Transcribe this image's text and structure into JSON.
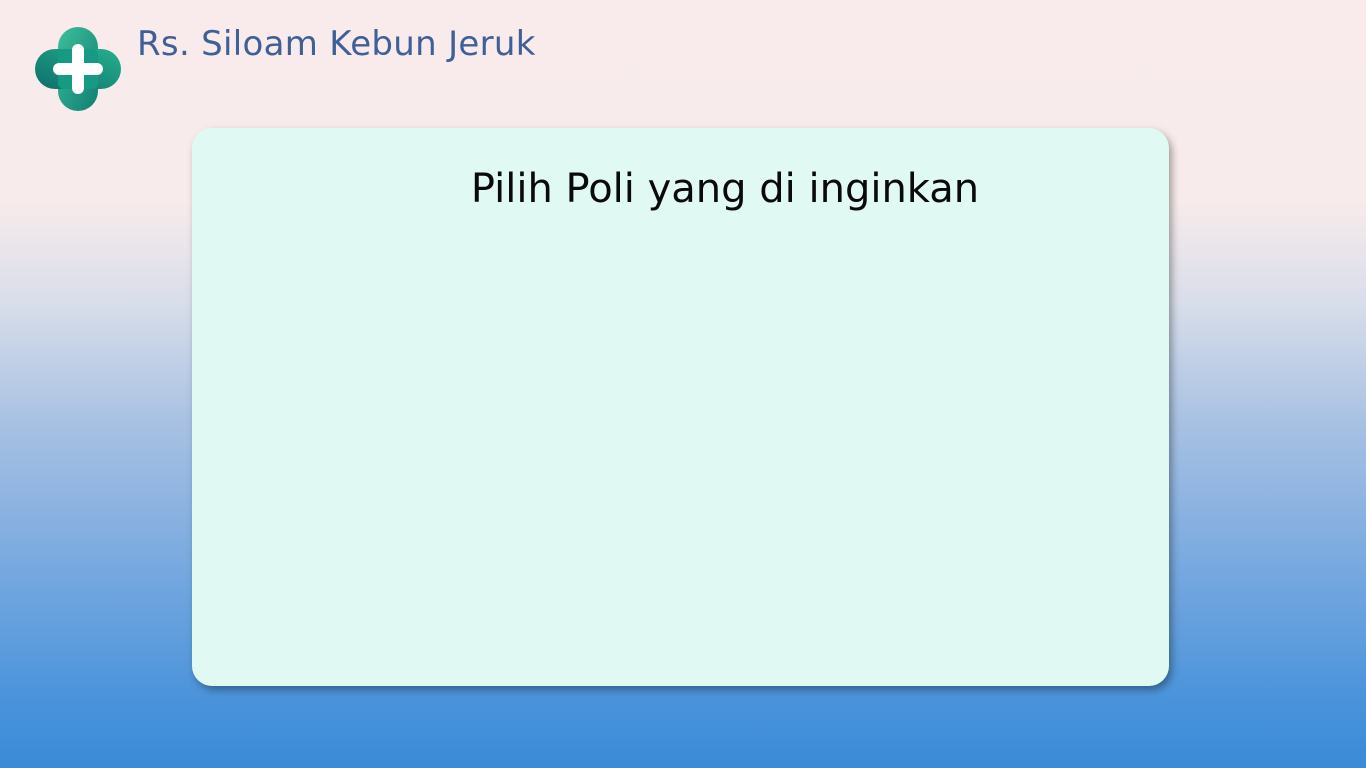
{
  "header": {
    "logo_icon": "medical-cross-icon",
    "hospital_name": "Rs. Siloam Kebun Jeruk"
  },
  "card": {
    "title": "Pilih Poli yang di inginkan"
  },
  "colors": {
    "brand_text": "#3f5f97",
    "logo_teal": "#1aa38a",
    "card_background": "#e1f9f3",
    "background_top": "#f9ebeb",
    "background_bottom": "#3a8bd8"
  }
}
